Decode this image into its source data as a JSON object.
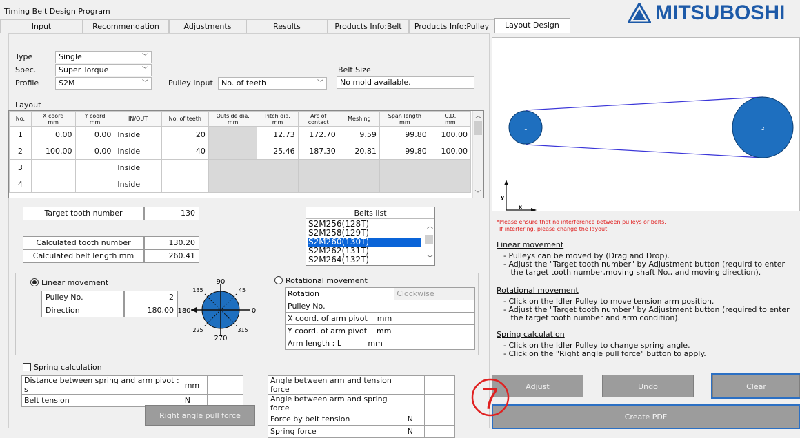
{
  "app": {
    "title": "Timing Belt Design Program"
  },
  "tabs": [
    {
      "label": "Input"
    },
    {
      "label": "Recommendation"
    },
    {
      "label": "Adjustments"
    },
    {
      "label": "Results"
    },
    {
      "label": "Products Info:Belt"
    },
    {
      "label": "Products Info:Pulley"
    },
    {
      "label": "Layout Design"
    }
  ],
  "brand": {
    "name": "MITSUBOSHI",
    "color": "#1d5aa8"
  },
  "form": {
    "type_label": "Type",
    "type_value": "Single",
    "spec_label": "Spec.",
    "spec_value": "Super Torque",
    "profile_label": "Profile",
    "profile_value": "S2M",
    "pulley_input_label": "Pulley Input",
    "pulley_input_value": "No. of teeth",
    "belt_size_label": "Belt Size",
    "belt_size_value": "No mold available."
  },
  "layout": {
    "label": "Layout",
    "headers": [
      "No.",
      "X coord\nmm",
      "Y coord\nmm",
      "IN/OUT",
      "No. of teeth",
      "Outside dia.\nmm",
      "Pitch dia.\nmm",
      "Arc of\ncontact",
      "Meshing",
      "Span length\nmm",
      "C.D.\nmm"
    ],
    "rows": [
      [
        "1",
        "0.00",
        "0.00",
        "Inside",
        "20",
        "",
        "12.73",
        "172.70",
        "9.59",
        "99.80",
        "100.00"
      ],
      [
        "2",
        "100.00",
        "0.00",
        "Inside",
        "40",
        "",
        "25.46",
        "187.30",
        "20.81",
        "99.80",
        "100.00"
      ],
      [
        "3",
        "",
        "",
        "Inside",
        "",
        "",
        "",
        "",
        "",
        "",
        ""
      ],
      [
        "4",
        "",
        "",
        "Inside",
        "",
        "",
        "",
        "",
        "",
        "",
        ""
      ]
    ]
  },
  "target": {
    "label": "Target tooth number",
    "value": "130"
  },
  "calc": {
    "tooth_label": "Calculated tooth number",
    "tooth_value": "130.20",
    "length_label": "Calculated belt length  mm",
    "length_value": "260.41"
  },
  "belts": {
    "title": "Belts list",
    "items": [
      "S2M256(128T)",
      "S2M258(129T)",
      "S2M260(130T)",
      "S2M262(131T)",
      "S2M264(132T)"
    ],
    "selected_index": 2
  },
  "linear": {
    "label": "Linear movement",
    "pulley_label": "Pulley No.",
    "pulley_value": "2",
    "direction_label": "Direction",
    "direction_value": "180.00"
  },
  "compass": {
    "n": "90",
    "ne": "45",
    "e": "0",
    "nw": "135",
    "w": "180",
    "sw": "225",
    "s": "270",
    "se": "315"
  },
  "rotational": {
    "label": "Rotational movement",
    "rows": [
      {
        "label": "Rotation",
        "value": "Clockwise"
      },
      {
        "label": "Pulley No.",
        "value": ""
      },
      {
        "label": "X coord. of arm pivot    mm",
        "value": ""
      },
      {
        "label": "Y coord. of arm pivot    mm",
        "value": ""
      },
      {
        "label": "Arm length : L           mm",
        "value": ""
      }
    ]
  },
  "spring": {
    "label": "Spring calculation",
    "left_rows": [
      {
        "label": "Distance between spring and arm pivot : s",
        "unit": "mm"
      },
      {
        "label": "Belt tension",
        "unit": "N"
      }
    ],
    "right_rows": [
      {
        "label": "Angle between arm and tension force",
        "unit": ""
      },
      {
        "label": "Angle between arm and spring force",
        "unit": ""
      },
      {
        "label": "Force by belt tension",
        "unit": "N"
      },
      {
        "label": "Spring force",
        "unit": "N"
      }
    ],
    "button": "Right angle pull force"
  },
  "diagram": {
    "pulley1": "1",
    "pulley2": "2",
    "axis_x": "x",
    "axis_y": "y",
    "fill": "#1e6fbf"
  },
  "warning": {
    "line1": "*Please ensure that no interference between pulleys or belts.",
    "line2": "If interfering, please change the layout."
  },
  "help": {
    "linear_title": "Linear movement",
    "linear_lines": [
      "- Pulleys can be moved by (Drag and Drop).",
      "- Adjust the \"Target tooth number\" by Adjustment button (requird to enter",
      "   the target tooth number,moving shaft No., and moving direction)."
    ],
    "rot_title": "Rotational movement",
    "rot_lines": [
      "- Click on the Idler Pulley to move tension arm position.",
      "- Adjust the \"Target tooth number\" by Adjustment button (required to enter",
      "   the target tooth number and arm condition)."
    ],
    "spring_title": "Spring calculation",
    "spring_lines": [
      "- Click on the Idler Pulley to change spring angle.",
      "- Click on the \"Right angle pull force\" button to apply."
    ]
  },
  "buttons": {
    "adjust": "Adjust",
    "undo": "Undo",
    "clear": "Clear",
    "pdf": "Create PDF"
  },
  "annotation": {
    "number": "7",
    "color": "#e02020"
  }
}
